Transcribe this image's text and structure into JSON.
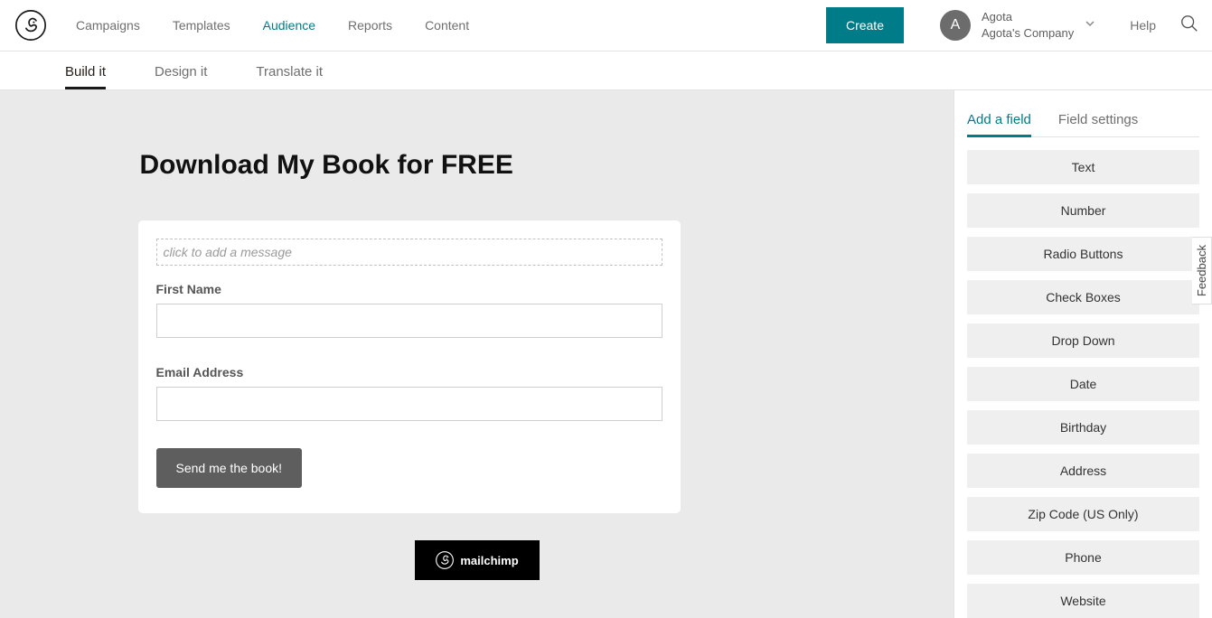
{
  "nav": {
    "items": [
      "Campaigns",
      "Templates",
      "Audience",
      "Reports",
      "Content"
    ],
    "create": "Create",
    "help": "Help"
  },
  "account": {
    "initial": "A",
    "name": "Agota",
    "company": "Agota's Company"
  },
  "subtabs": [
    "Build it",
    "Design it",
    "Translate it"
  ],
  "form": {
    "title": "Download My Book for FREE",
    "message_placeholder": "click to add a message",
    "first_name_label": "First Name",
    "email_label": "Email Address",
    "submit": "Send me the book!",
    "badge": "mailchimp"
  },
  "sidepanel": {
    "tabs": [
      "Add a field",
      "Field settings"
    ],
    "fields": [
      "Text",
      "Number",
      "Radio Buttons",
      "Check Boxes",
      "Drop Down",
      "Date",
      "Birthday",
      "Address",
      "Zip Code (US Only)",
      "Phone",
      "Website"
    ]
  },
  "feedback": "Feedback"
}
